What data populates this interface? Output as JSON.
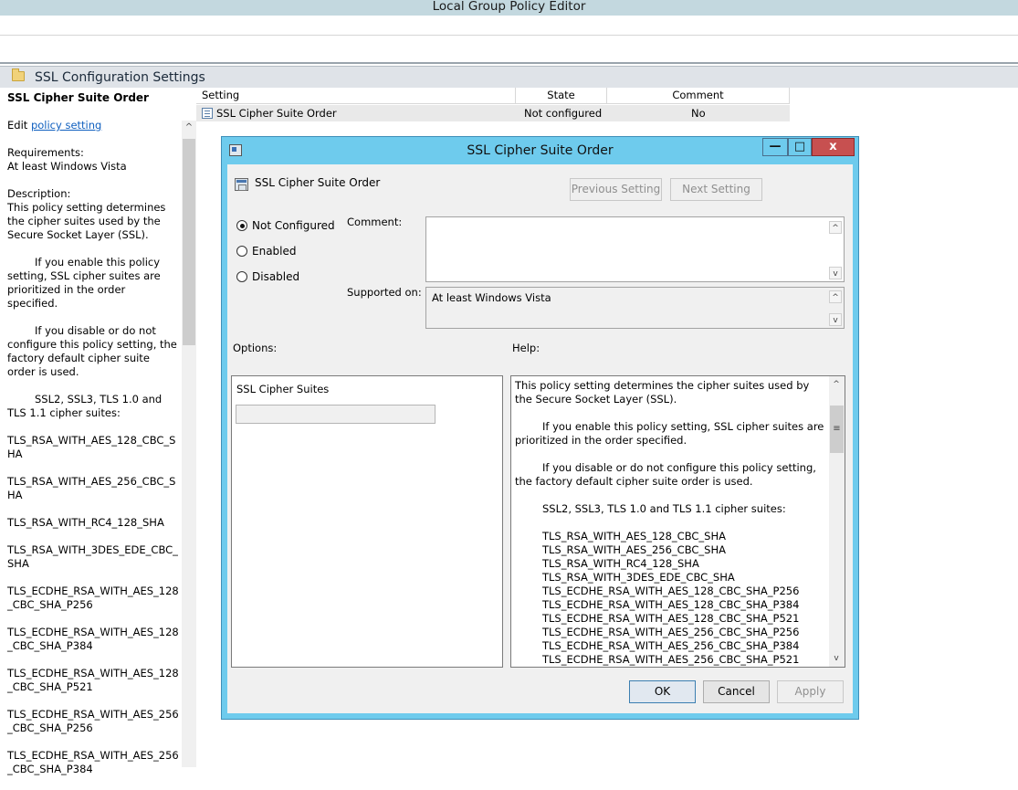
{
  "app": {
    "title": "Local Group Policy Editor"
  },
  "node": {
    "title": "SSL Configuration Settings"
  },
  "left_pane": {
    "heading": "SSL Cipher Suite Order",
    "edit_prefix": "Edit ",
    "edit_link": "policy setting ",
    "requirements_label": "Requirements:",
    "requirements_value": "At least Windows Vista",
    "description_label": "Description:",
    "paragraphs": [
      "This policy setting determines the cipher suites used by the Secure Socket Layer (SSL).",
      "If you enable this policy setting, SSL cipher suites are prioritized in the order specified.",
      "If you disable or do not configure this policy setting, the factory default cipher suite order is used.",
      "SSL2, SSL3, TLS 1.0 and TLS 1.1 cipher suites:"
    ],
    "suites": [
      "TLS_RSA_WITH_AES_128_CBC_SHA",
      "TLS_RSA_WITH_AES_256_CBC_SHA",
      "TLS_RSA_WITH_RC4_128_SHA",
      "TLS_RSA_WITH_3DES_EDE_CBC_SHA",
      "TLS_ECDHE_RSA_WITH_AES_128_CBC_SHA_P256",
      "TLS_ECDHE_RSA_WITH_AES_128_CBC_SHA_P384",
      "TLS_ECDHE_RSA_WITH_AES_128_CBC_SHA_P521",
      "TLS_ECDHE_RSA_WITH_AES_256_CBC_SHA_P256",
      "TLS_ECDHE_RSA_WITH_AES_256_CBC_SHA_P384"
    ]
  },
  "list": {
    "headers": {
      "setting": "Setting",
      "state": "State",
      "comment": "Comment"
    },
    "rows": [
      {
        "setting": "SSL Cipher Suite Order",
        "state": "Not configured",
        "comment": "No"
      }
    ]
  },
  "dialog": {
    "title": "SSL Cipher Suite Order",
    "buttons": {
      "min": "—",
      "max": "□",
      "close": "x"
    },
    "setting_name": "SSL Cipher Suite Order",
    "prev_button": "Previous Setting",
    "next_button": "Next Setting",
    "radios": {
      "not_configured": "Not Configured",
      "enabled": "Enabled",
      "disabled": "Disabled"
    },
    "comment_label": "Comment:",
    "supported_label": "Supported on:",
    "supported_value": "At least Windows Vista",
    "options_label": "Options:",
    "help_label": "Help:",
    "options_field_label": "SSL Cipher Suites",
    "help_paragraphs": [
      "This policy setting determines the cipher suites used by the Secure Socket Layer (SSL).",
      "If you enable this policy setting, SSL cipher suites are prioritized in the order specified.",
      "If you disable or do not configure this policy setting, the factory default cipher suite order is used.",
      "SSL2, SSL3, TLS 1.0 and TLS 1.1 cipher suites:"
    ],
    "help_suites": [
      "TLS_RSA_WITH_AES_128_CBC_SHA",
      "TLS_RSA_WITH_AES_256_CBC_SHA",
      "TLS_RSA_WITH_RC4_128_SHA",
      "TLS_RSA_WITH_3DES_EDE_CBC_SHA",
      "TLS_ECDHE_RSA_WITH_AES_128_CBC_SHA_P256",
      "TLS_ECDHE_RSA_WITH_AES_128_CBC_SHA_P384",
      "TLS_ECDHE_RSA_WITH_AES_128_CBC_SHA_P521",
      "TLS_ECDHE_RSA_WITH_AES_256_CBC_SHA_P256",
      "TLS_ECDHE_RSA_WITH_AES_256_CBC_SHA_P384",
      "TLS_ECDHE_RSA_WITH_AES_256_CBC_SHA_P521"
    ],
    "ok": "OK",
    "cancel": "Cancel",
    "apply": "Apply"
  },
  "colors": {
    "dialog_frame": "#6ecbed",
    "title_bar": "#c3d8df",
    "close_button": "#c75050",
    "link": "#0f5fbf"
  }
}
